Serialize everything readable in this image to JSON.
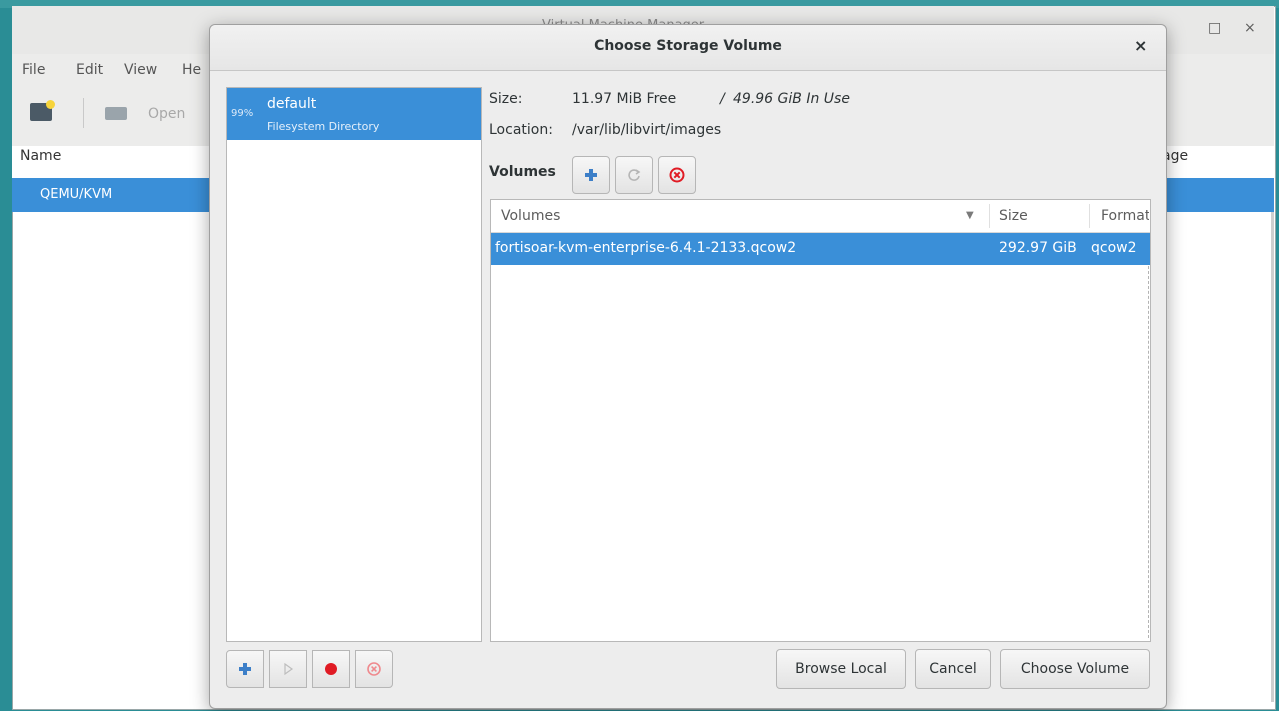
{
  "background_window": {
    "title": "Virtual Machine Manager",
    "menu": [
      "File",
      "Edit",
      "View",
      "He"
    ],
    "toolbar": {
      "open_label": "Open"
    },
    "columns": {
      "name": "Name",
      "usage": "age"
    },
    "rows": [
      {
        "label": "QEMU/KVM"
      }
    ]
  },
  "dialog": {
    "title": "Choose Storage Volume",
    "close_glyph": "×",
    "pools": [
      {
        "percent": "99%",
        "name": "default",
        "type": "Filesystem Directory"
      }
    ],
    "info": {
      "size_label": "Size:",
      "free": "11.97 MiB Free",
      "separator": "/",
      "in_use": "49.96 GiB In Use",
      "location_label": "Location:",
      "location": "/var/lib/libvirt/images"
    },
    "volumes_label": "Volumes",
    "table": {
      "headers": {
        "name": "Volumes",
        "size": "Size",
        "format": "Format"
      },
      "rows": [
        {
          "name": "fortisoar-kvm-enterprise-6.4.1-2133.qcow2",
          "size": "292.97 GiB",
          "format": "qcow2"
        }
      ]
    },
    "buttons": {
      "browse_local": "Browse Local",
      "cancel": "Cancel",
      "choose_volume": "Choose Volume"
    }
  },
  "colors": {
    "selection": "#3a8fd8",
    "desktop": "#2a8d95",
    "add_icon": "#3d7fc8",
    "stop_icon": "#e01b24"
  }
}
